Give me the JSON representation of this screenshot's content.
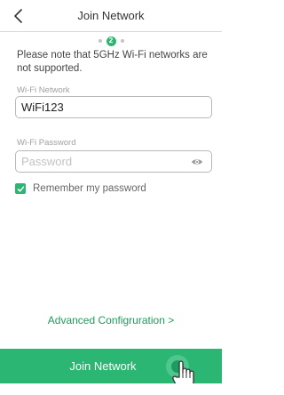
{
  "header": {
    "title": "Join Network",
    "back_icon": "chevron-left-icon"
  },
  "stepper": {
    "active_step_label": "2"
  },
  "notice": "Please note that 5GHz Wi-Fi networks are not supported.",
  "wifi_network": {
    "label": "Wi-Fi Network",
    "value": "WiFi123"
  },
  "wifi_password": {
    "label": "Wi-Fi Password",
    "placeholder": "Password",
    "toggle_icon": "eye-icon"
  },
  "remember": {
    "label": "Remember my password",
    "checked": true
  },
  "advanced_link": "Advanced Configruration  >",
  "join_button": {
    "label": "Join Network"
  },
  "overlay": {
    "icon": "hand-pointer-icon"
  },
  "colors": {
    "accent": "#2bb673",
    "accent_dark": "#1e9c5e",
    "ripple": "#6fd3a5"
  }
}
